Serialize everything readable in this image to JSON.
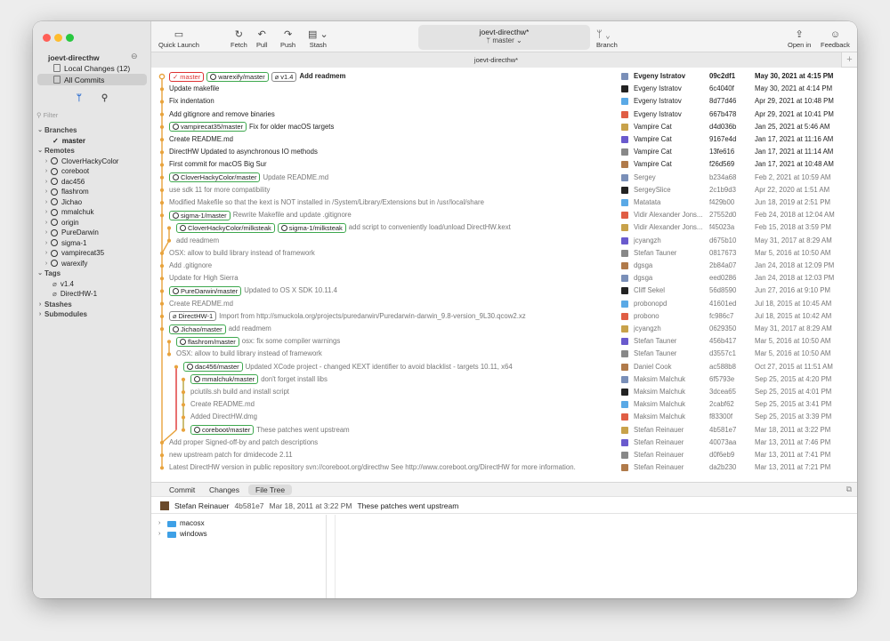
{
  "sidebar": {
    "repo": "joevt-directhw",
    "nav": [
      {
        "label": "Local Changes (12)",
        "icon": "document-icon"
      },
      {
        "label": "All Commits",
        "icon": "list-icon"
      }
    ],
    "filter_placeholder": "Filter",
    "branches_header": "Branches",
    "branches": [
      "master"
    ],
    "remotes_header": "Remotes",
    "remotes": [
      "CloverHackyColor",
      "coreboot",
      "dac456",
      "flashrom",
      "Jichao",
      "mmalchuk",
      "origin",
      "PureDarwin",
      "sigma-1",
      "vampirecat35",
      "warexify"
    ],
    "tags_header": "Tags",
    "tags": [
      "v1.4",
      "DirectHW-1"
    ],
    "stashes_header": "Stashes",
    "submodules_header": "Submodules"
  },
  "toolbar": {
    "quick_launch": "Quick Launch",
    "fetch": "Fetch",
    "pull": "Pull",
    "push": "Push",
    "stash": "Stash",
    "title": "joevt-directhw*",
    "branch_sub": "master",
    "branch": "Branch",
    "open_in": "Open in",
    "feedback": "Feedback",
    "tab": "joevt-directhw*"
  },
  "commits": [
    {
      "refs": [
        {
          "t": "cur",
          "l": "master"
        },
        {
          "t": "r",
          "l": "warexify/master"
        },
        {
          "t": "tag",
          "l": "v1.4"
        }
      ],
      "msg": "Add readmem",
      "author": "Evgeny Istratov",
      "sha": "09c2df1",
      "date": "May 30, 2021 at 4:15 PM",
      "head": true
    },
    {
      "msg": "Update makefile",
      "author": "Evgeny Istratov",
      "sha": "6c4040f",
      "date": "May 30, 2021 at 4:14 PM"
    },
    {
      "msg": "Fix indentation",
      "author": "Evgeny Istratov",
      "sha": "8d77d46",
      "date": "Apr 29, 2021 at 10:48 PM"
    },
    {
      "msg": "Add gitignore and remove binaries",
      "author": "Evgeny Istratov",
      "sha": "667b478",
      "date": "Apr 29, 2021 at 10:41 PM"
    },
    {
      "refs": [
        {
          "t": "r",
          "l": "vampirecat35/master"
        }
      ],
      "msg": "Fix for older macOS targets",
      "author": "Vampire Cat",
      "sha": "d4d036b",
      "date": "Jan 25, 2021 at 5:46 AM"
    },
    {
      "msg": "Create README.md",
      "author": "Vampire Cat",
      "sha": "9167e4d",
      "date": "Jan 17, 2021 at 11:16 AM"
    },
    {
      "msg": "DirectHW Updated to asynchronous IO methods",
      "author": "Vampire Cat",
      "sha": "13fe616",
      "date": "Jan 17, 2021 at 11:14 AM"
    },
    {
      "msg": "First commit for macOS Big Sur",
      "author": "Vampire Cat",
      "sha": "f26d569",
      "date": "Jan 17, 2021 at 10:48 AM"
    },
    {
      "refs": [
        {
          "t": "r",
          "l": "CloverHackyColor/master"
        }
      ],
      "msg": "Update README.md",
      "author": "Sergey",
      "sha": "b234a68",
      "date": "Feb 2, 2021 at 10:59 AM",
      "dim": true
    },
    {
      "msg": "use sdk 11 for more compatibility",
      "author": "SergeySlice",
      "sha": "2c1b9d3",
      "date": "Apr 22, 2020 at 1:51 AM",
      "dim": true
    },
    {
      "msg": "Modified Makefile so that the kext is NOT installed in /System/Library/Extensions but in /usr/local/share",
      "author": "Matatata",
      "sha": "f429b00",
      "date": "Jun 18, 2019 at 2:51 PM",
      "dim": true
    },
    {
      "refs": [
        {
          "t": "r",
          "l": "sigma-1/master"
        }
      ],
      "msg": "Rewrite Makefile and update .gitignore",
      "author": "Vidir Alexander Jons...",
      "sha": "27552d0",
      "date": "Feb 24, 2018 at 12:04 AM",
      "dim": true
    },
    {
      "refs": [
        {
          "t": "r",
          "l": "CloverHackyColor/milksteak"
        },
        {
          "t": "r",
          "l": "sigma-1/milksteak"
        }
      ],
      "msg": "add script to conveniently load/unload DirectHW.kext",
      "author": "Vidir Alexander Jons...",
      "sha": "f45023a",
      "date": "Feb 15, 2018 at 3:59 PM",
      "dim": true
    },
    {
      "msg": "add readmem",
      "author": "jcyangzh",
      "sha": "d675b10",
      "date": "May 31, 2017 at 8:29 AM",
      "dim": true
    },
    {
      "msg": "OSX: allow to build library instead of framework",
      "author": "Stefan Tauner",
      "sha": "0817673",
      "date": "Mar 5, 2016 at 10:50 AM",
      "dim": true
    },
    {
      "msg": "Add .gitignore",
      "author": "dgsga",
      "sha": "2b84a07",
      "date": "Jan 24, 2018 at 12:09 PM",
      "dim": true
    },
    {
      "msg": "Update for High Sierra",
      "author": "dgsga",
      "sha": "eed0286",
      "date": "Jan 24, 2018 at 12:03 PM",
      "dim": true
    },
    {
      "refs": [
        {
          "t": "r",
          "l": "PureDarwin/master"
        }
      ],
      "msg": "Updated to OS X SDK 10.11.4",
      "author": "Cliff Sekel",
      "sha": "56d8590",
      "date": "Jun 27, 2016 at 9:10 PM",
      "dim": true
    },
    {
      "msg": "Create README.md",
      "author": "probonopd",
      "sha": "41601ed",
      "date": "Jul 18, 2015 at 10:45 AM",
      "dim": true
    },
    {
      "refs": [
        {
          "t": "tag",
          "l": "DirectHW-1"
        }
      ],
      "msg": "Import from http://smuckola.org/projects/puredarwin/Puredarwin-darwin_9.8-version_9L30.qcow2.xz",
      "author": "probono",
      "sha": "fc986c7",
      "date": "Jul 18, 2015 at 10:42 AM",
      "dim": true
    },
    {
      "refs": [
        {
          "t": "r",
          "l": "Jichao/master"
        }
      ],
      "msg": "add readmem",
      "author": "jcyangzh",
      "sha": "0629350",
      "date": "May 31, 2017 at 8:29 AM",
      "dim": true
    },
    {
      "refs": [
        {
          "t": "r",
          "l": "flashrom/master"
        }
      ],
      "msg": "osx: fix some compiler warnings",
      "author": "Stefan Tauner",
      "sha": "456b417",
      "date": "Mar 5, 2016 at 10:50 AM",
      "dim": true
    },
    {
      "msg": "OSX: allow to build library instead of framework",
      "author": "Stefan Tauner",
      "sha": "d3557c1",
      "date": "Mar 5, 2016 at 10:50 AM",
      "dim": true
    },
    {
      "refs": [
        {
          "t": "r",
          "l": "dac456/master"
        }
      ],
      "msg": "Updated XCode project - changed KEXT identifier to avoid blacklist - targets 10.11, x64",
      "author": "Daniel Cook",
      "sha": "ac588b8",
      "date": "Oct 27, 2015 at 11:51 AM",
      "dim": true
    },
    {
      "refs": [
        {
          "t": "r",
          "l": "mmalchuk/master"
        }
      ],
      "msg": "don't forget install libs",
      "author": "Maksim Malchuk",
      "sha": "6f5793e",
      "date": "Sep 25, 2015 at 4:20 PM",
      "dim": true
    },
    {
      "msg": "pciutils.sh build and install script",
      "author": "Maksim Malchuk",
      "sha": "3dcea65",
      "date": "Sep 25, 2015 at 4:01 PM",
      "dim": true
    },
    {
      "msg": "Create README.md",
      "author": "Maksim Malchuk",
      "sha": "2cabf62",
      "date": "Sep 25, 2015 at 3:41 PM",
      "dim": true
    },
    {
      "msg": "Added DirectHW.dmg",
      "author": "Maksim Malchuk",
      "sha": "f83300f",
      "date": "Sep 25, 2015 at 3:39 PM",
      "dim": true
    },
    {
      "refs": [
        {
          "t": "r",
          "l": "coreboot/master"
        }
      ],
      "msg": "These patches went upstream",
      "author": "Stefan Reinauer",
      "sha": "4b581e7",
      "date": "Mar 18, 2011 at 3:22 PM",
      "dim": true
    },
    {
      "msg": "Add proper Signed-off-by and patch descriptions",
      "author": "Stefan Reinauer",
      "sha": "40073aa",
      "date": "Mar 13, 2011 at 7:46 PM",
      "dim": true
    },
    {
      "msg": "new upstream patch for dmidecode 2.11",
      "author": "Stefan Reinauer",
      "sha": "d0f6eb9",
      "date": "Mar 13, 2011 at 7:41 PM",
      "dim": true
    },
    {
      "msg": "Latest DirectHW version in public repository svn://coreboot.org/directhw See http://www.coreboot.org/DirectHW for more information.",
      "author": "Stefan Reinauer",
      "sha": "da2b230",
      "date": "Mar 13, 2011 at 7:21 PM",
      "dim": true
    }
  ],
  "lower": {
    "tabs": [
      "Commit",
      "Changes",
      "File Tree"
    ],
    "selected_tab": "File Tree",
    "info": {
      "author": "Stefan Reinauer",
      "sha": "4b581e7",
      "date": "Mar 18, 2011 at 3:22 PM",
      "msg": "These patches went upstream"
    },
    "files": [
      "macosx",
      "windows"
    ]
  },
  "colors": {
    "graph_main": "#e8a33d",
    "graph_red": "#d33",
    "graph_olive": "#b5a33a",
    "graph_grey": "#9a9a9a",
    "ref_green": "#3ea84e",
    "accent": "#2b6ccf"
  }
}
